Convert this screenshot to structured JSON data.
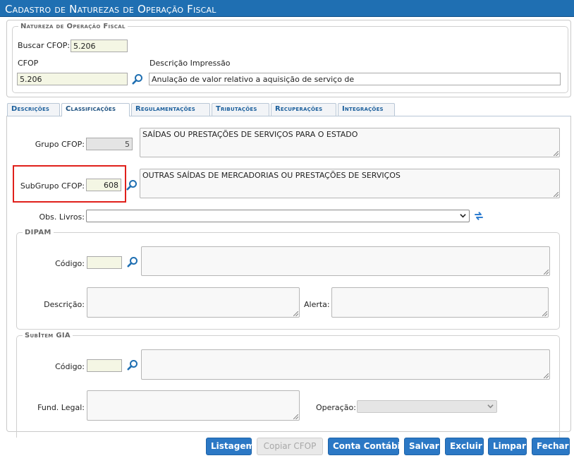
{
  "window": {
    "title": "Cadastro de Naturezas de Operação Fiscal"
  },
  "header_section": {
    "legend": "Natureza de Operação Fiscal",
    "buscar_cfop_label": "Buscar CFOP:",
    "buscar_cfop_value": "5.206",
    "cfop_label": "CFOP",
    "cfop_value": "5.206",
    "descricao_impressao_label": "Descrição Impressão",
    "descricao_impressao_value": "Anulação de valor relativo a aquisição de serviço de"
  },
  "tabs": [
    {
      "label": "Descrições"
    },
    {
      "label": "Classificações"
    },
    {
      "label": "Regulamentações"
    },
    {
      "label": "Tributações"
    },
    {
      "label": "Recuperações"
    },
    {
      "label": "Integrações"
    }
  ],
  "classificacoes": {
    "grupo_cfop_label": "Grupo CFOP:",
    "grupo_cfop_value": "5",
    "grupo_cfop_desc": "SAÍDAS OU PRESTAÇÕES DE SERVIÇOS PARA O ESTADO",
    "subgrupo_cfop_label": "SubGrupo CFOP:",
    "subgrupo_cfop_value": "608",
    "subgrupo_cfop_desc": "OUTRAS SAÍDAS DE MERCADORIAS OU PRESTAÇÕES DE SERVIÇOS",
    "obs_livros_label": "Obs. Livros:",
    "obs_livros_value": ""
  },
  "dipam": {
    "legend": "DIPAM",
    "codigo_label": "Código:",
    "codigo_value": "",
    "codigo_desc": "",
    "descricao_label": "Descrição:",
    "descricao_value": "",
    "alerta_label": "Alerta:",
    "alerta_value": ""
  },
  "subitem_gia": {
    "legend": "SubItem GIA",
    "codigo_label": "Código:",
    "codigo_value": "",
    "codigo_desc": "",
    "fund_legal_label": "Fund. Legal:",
    "fund_legal_value": "",
    "operacao_label": "Operação:",
    "operacao_value": ""
  },
  "buttons": {
    "listagem": "Listagem",
    "copiar_cfop": "Copiar CFOP",
    "conta_contabil": "Conta Contábil",
    "salvar": "Salvar",
    "excluir": "Excluir",
    "limpar": "Limpar",
    "fechar": "Fechar"
  },
  "colors": {
    "title_bar": "#1f6fb2",
    "button": "#2b78c5",
    "highlight_box": "#e0201b",
    "link_tab_text": "#1b5f9c"
  }
}
